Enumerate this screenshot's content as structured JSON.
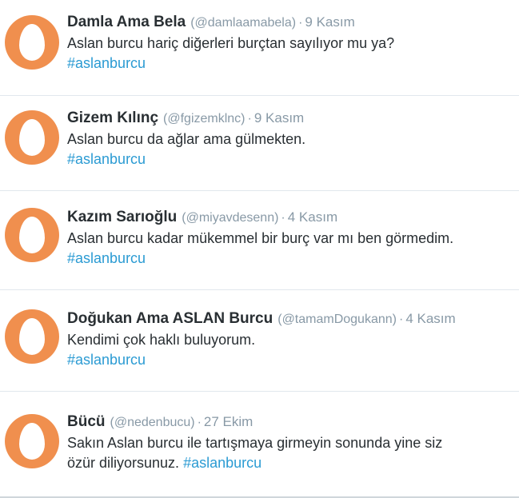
{
  "tweets": [
    {
      "name": "Damla Ama Bela",
      "handle": "(@damlaamabela)",
      "separator": "·",
      "time": "9 Kasım",
      "text": "Aslan burcu hariç diğerleri burçtan sayılıyor mu ya?",
      "hashtag": "#aslanburcu",
      "avatar_icon": "default-egg-avatar",
      "avatar_color": "#f08f4e"
    },
    {
      "name": "Gizem Kılınç",
      "handle": "(@fgizemklnc)",
      "separator": "·",
      "time": "9 Kasım",
      "text": "Aslan burcu da ağlar ama gülmekten.",
      "hashtag": "#aslanburcu",
      "avatar_icon": "default-egg-avatar",
      "avatar_color": "#f08f4e"
    },
    {
      "name": "Kazım Sarıoğlu",
      "handle": "(@miyavdesenn)",
      "separator": "·",
      "time": "4 Kasım",
      "text": "Aslan burcu kadar mükemmel bir burç var mı ben görmedim.",
      "hashtag": "#aslanburcu",
      "avatar_icon": "default-egg-avatar",
      "avatar_color": "#f08f4e"
    },
    {
      "name": "Doğukan Ama ASLAN Burcu",
      "handle": "(@tamamDogukann)",
      "separator": "·",
      "time": "4 Kasım",
      "text": "Kendimi çok haklı buluyorum.",
      "hashtag": "#aslanburcu",
      "avatar_icon": "default-egg-avatar",
      "avatar_color": "#f08f4e"
    },
    {
      "name": "Bücü",
      "handle": "(@nedenbucu)",
      "separator": "·",
      "time": "27 Ekim",
      "text_line1": "Sakın Aslan burcu ile tartışmaya girmeyin sonunda yine siz",
      "text_line2": "özür diliyorsunuz.",
      "hashtag": "#aslanburcu",
      "avatar_icon": "default-egg-avatar",
      "avatar_color": "#f08f4e"
    }
  ],
  "colors": {
    "name": "#292f33",
    "meta": "#8899a6",
    "hashtag": "#2b9bd3",
    "divider": "#e1e8ed"
  }
}
